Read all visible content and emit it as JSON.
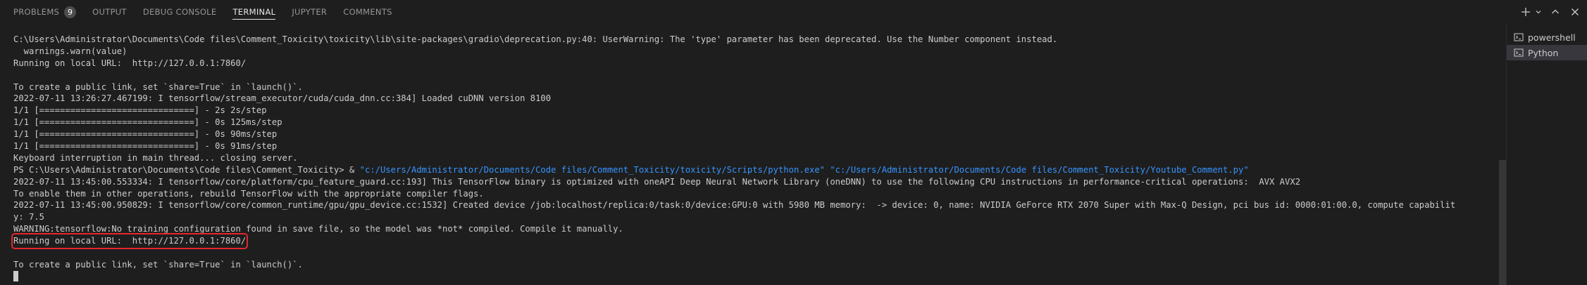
{
  "panel": {
    "tabs": [
      {
        "label": "PROBLEMS",
        "badge": "9"
      },
      {
        "label": "OUTPUT"
      },
      {
        "label": "DEBUG CONSOLE"
      },
      {
        "label": "TERMINAL",
        "active": true
      },
      {
        "label": "JUPYTER"
      },
      {
        "label": "COMMENTS"
      }
    ],
    "actions": [
      "new-terminal-plus-icon",
      "launch-profile-chevron-icon",
      "maximize-panel-chevron-up-icon",
      "close-panel-icon"
    ]
  },
  "terminals": [
    {
      "label": "powershell",
      "icon": "terminal-icon"
    },
    {
      "label": "Python",
      "icon": "terminal-icon",
      "active": true
    }
  ],
  "terminal": {
    "lines": [
      "C:\\Users\\Administrator\\Documents\\Code files\\Comment_Toxicity\\toxicity\\lib\\site-packages\\gradio\\deprecation.py:40: UserWarning: The 'type' parameter has been deprecated. Use the Number component instead.",
      "  warnings.warn(value)",
      "Running on local URL:  http://127.0.0.1:7860/",
      "",
      "To create a public link, set `share=True` in `launch()`.",
      "2022-07-11 13:26:27.467199: I tensorflow/stream_executor/cuda/cuda_dnn.cc:384] Loaded cuDNN version 8100",
      "1/1 [==============================] - 2s 2s/step",
      "1/1 [==============================] - 0s 125ms/step",
      "1/1 [==============================] - 0s 90ms/step",
      "1/1 [==============================] - 0s 91ms/step",
      "Keyboard interruption in main thread... closing server.",
      "",
      "2022-07-11 13:45:00.553334: I tensorflow/core/platform/cpu_feature_guard.cc:193] This TensorFlow binary is optimized with oneAPI Deep Neural Network Library (oneDNN) to use the following CPU instructions in performance-critical operations:  AVX AVX2",
      "To enable them in other operations, rebuild TensorFlow with the appropriate compiler flags.",
      "2022-07-11 13:45:00.950829: I tensorflow/core/common_runtime/gpu/gpu_device.cc:1532] Created device /job:localhost/replica:0/task:0/device:GPU:0 with 5980 MB memory:  -> device: 0, name: NVIDIA GeForce RTX 2070 Super with Max-Q Design, pci bus id: 0000:01:00.0, compute capabilit",
      "y: 7.5",
      "WARNING:tensorflow:No training configuration found in save file, so the model was *not* compiled. Compile it manually.",
      "Running on local URL:  http://127.0.0.1:7860/",
      "",
      "To create a public link, set `share=True` in `launch()`."
    ],
    "command": {
      "prompt": "PS C:\\Users\\Administrator\\Documents\\Code files\\Comment_Toxicity> & ",
      "exe": "\"c:/Users/Administrator/Documents/Code files/Comment_Toxicity/toxicity/Scripts/python.exe\"",
      "script": "\"c:/Users/Administrator/Documents/Code files/Comment_Toxicity/Youtube_Comment.py\""
    },
    "highlight_color": "#e5262e",
    "link_color": "#3794ff"
  }
}
